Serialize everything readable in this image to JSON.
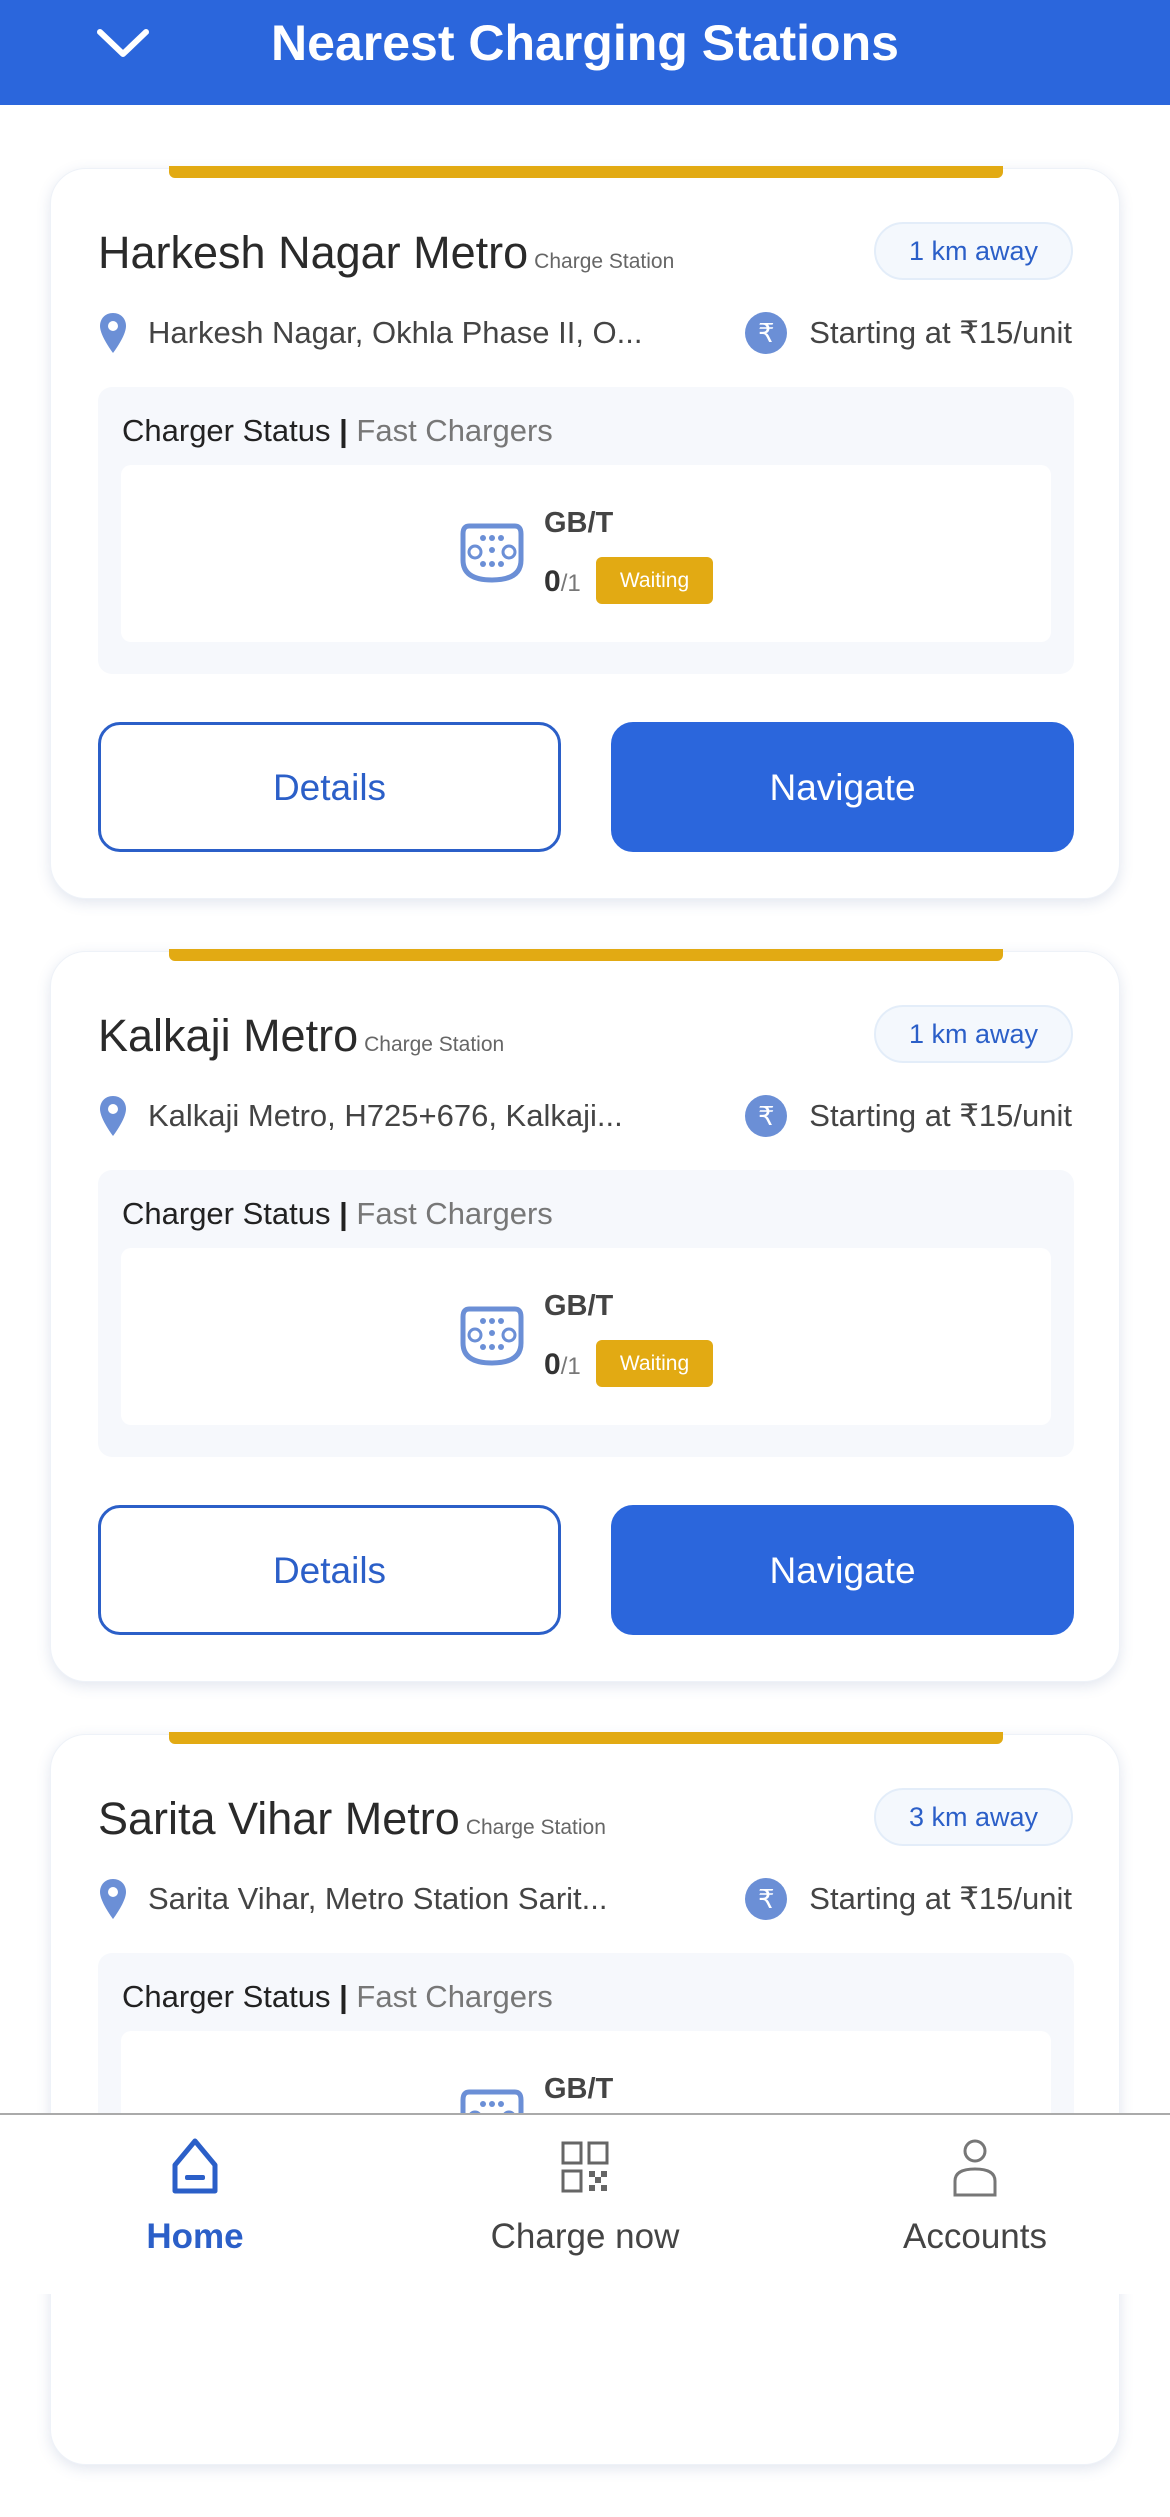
{
  "header": {
    "title": "Nearest Charging Stations",
    "back_icon": "chevron-down-icon"
  },
  "stations": [
    {
      "name": "Harkesh Nagar Metro",
      "type": "Charge Station",
      "distance": "1 km away",
      "address": "Harkesh Nagar, Okhla Phase II, O...",
      "price": "Starting at ₹15/unit",
      "status_label": "Charger Status",
      "status_sep": " | ",
      "status_category": "Fast Chargers",
      "charger": {
        "type": "GB/T",
        "available": "0",
        "total": "/1",
        "state": "Waiting"
      },
      "details": "Details",
      "navigate": "Navigate"
    },
    {
      "name": "Kalkaji Metro",
      "type": "Charge Station",
      "distance": "1 km away",
      "address": "Kalkaji Metro, H725+676, Kalkaji...",
      "price": "Starting at ₹15/unit",
      "status_label": "Charger Status",
      "status_sep": " | ",
      "status_category": "Fast Chargers",
      "charger": {
        "type": "GB/T",
        "available": "0",
        "total": "/1",
        "state": "Waiting"
      },
      "details": "Details",
      "navigate": "Navigate"
    },
    {
      "name": "Sarita Vihar Metro",
      "type": "Charge Station",
      "distance": "3 km away",
      "address": "Sarita Vihar, Metro Station Sarit...",
      "price": "Starting at ₹15/unit",
      "status_label": "Charger Status",
      "status_sep": " | ",
      "status_category": "Fast Chargers",
      "charger": {
        "type": "GB/T"
      }
    }
  ],
  "bottom_nav": [
    {
      "label": "Home",
      "icon": "home-icon",
      "active": true
    },
    {
      "label": "Charge now",
      "icon": "qr-code-icon"
    },
    {
      "label": "Accounts",
      "icon": "user-icon"
    }
  ],
  "colors": {
    "primary": "#2b66dc",
    "accent": "#e2aa13"
  }
}
